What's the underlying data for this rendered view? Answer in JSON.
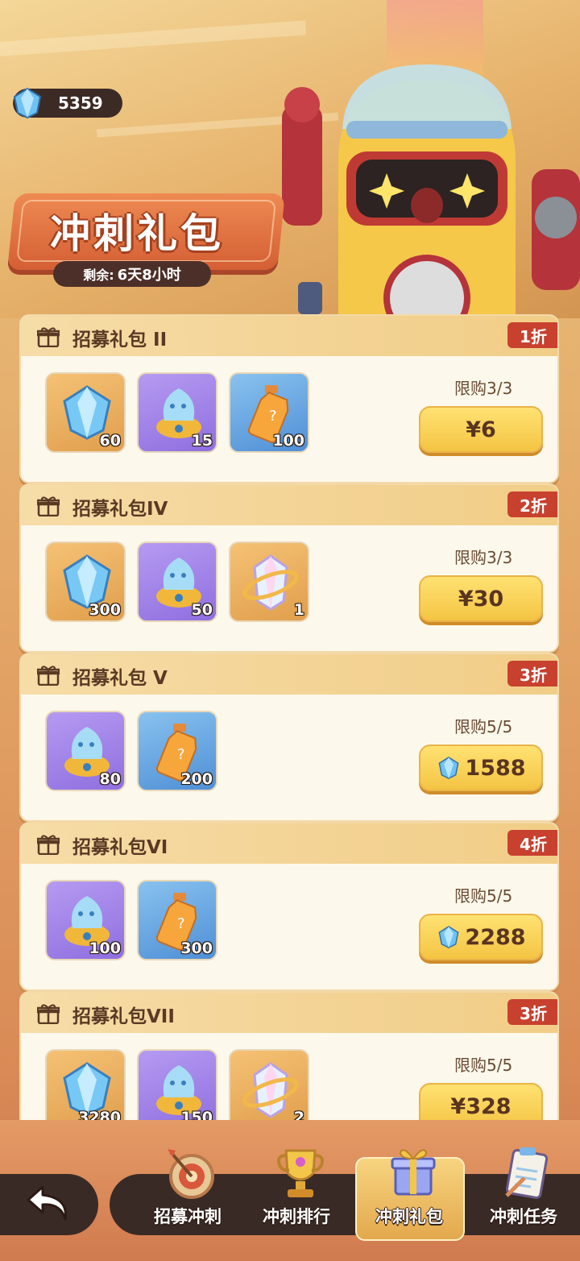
{
  "header": {
    "gems": "5359",
    "title": "冲刺礼包",
    "timer_label": "剩余:",
    "timer_value": "6天8小时"
  },
  "packs": [
    {
      "name": "招募礼包 II",
      "discount": "1折",
      "limit": "限购3/3",
      "price": "¥6",
      "currency": "cny",
      "items": [
        {
          "icon": "diamond-icon",
          "bg": "gold",
          "count": "60"
        },
        {
          "icon": "spirit-pot-icon",
          "bg": "purple",
          "count": "15"
        },
        {
          "icon": "potion-bottle-icon",
          "bg": "blue",
          "count": "100"
        }
      ]
    },
    {
      "name": "招募礼包IV",
      "discount": "2折",
      "limit": "限购3/3",
      "price": "¥30",
      "currency": "cny",
      "items": [
        {
          "icon": "diamond-icon",
          "bg": "gold",
          "count": "300"
        },
        {
          "icon": "spirit-pot-icon",
          "bg": "purple",
          "count": "50"
        },
        {
          "icon": "crystal-ring-icon",
          "bg": "gold",
          "count": "1"
        }
      ]
    },
    {
      "name": "招募礼包 V",
      "discount": "3折",
      "limit": "限购5/5",
      "price": "1588",
      "currency": "gem",
      "items": [
        {
          "icon": "spirit-pot-icon",
          "bg": "purple",
          "count": "80"
        },
        {
          "icon": "potion-bottle-icon",
          "bg": "blue",
          "count": "200"
        }
      ]
    },
    {
      "name": "招募礼包VI",
      "discount": "4折",
      "limit": "限购5/5",
      "price": "2288",
      "currency": "gem",
      "items": [
        {
          "icon": "spirit-pot-icon",
          "bg": "purple",
          "count": "100"
        },
        {
          "icon": "potion-bottle-icon",
          "bg": "blue",
          "count": "300"
        }
      ]
    },
    {
      "name": "招募礼包VII",
      "discount": "3折",
      "limit": "限购5/5",
      "price": "¥328",
      "currency": "cny",
      "items": [
        {
          "icon": "diamond-icon",
          "bg": "gold",
          "count": "3280"
        },
        {
          "icon": "spirit-pot-icon",
          "bg": "purple",
          "count": "150"
        },
        {
          "icon": "crystal-ring-icon",
          "bg": "gold",
          "count": "2"
        }
      ]
    }
  ],
  "nav": {
    "tabs": [
      {
        "label": "招募冲刺",
        "icon": "dartboard-icon"
      },
      {
        "label": "冲刺排行",
        "icon": "trophy-icon"
      },
      {
        "label": "冲刺礼包",
        "icon": "gift-box-icon",
        "active": true
      },
      {
        "label": "冲刺任务",
        "icon": "clipboard-icon"
      }
    ]
  },
  "colors": {
    "accent": "#f4c443",
    "discount": "#c8402e",
    "dark": "#3a2a25"
  }
}
